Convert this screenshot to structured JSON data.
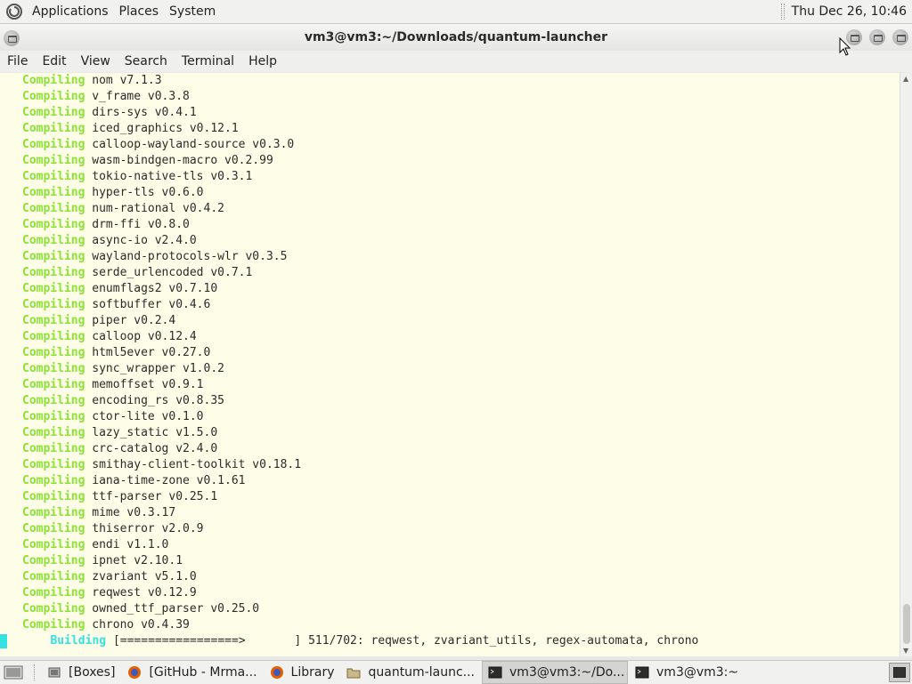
{
  "top_panel": {
    "menus": [
      "Applications",
      "Places",
      "System"
    ],
    "clock": "Thu Dec 26, 10:46"
  },
  "window": {
    "title": "vm3@vm3:~/Downloads/quantum-launcher"
  },
  "menubar": [
    "File",
    "Edit",
    "View",
    "Search",
    "Terminal",
    "Help"
  ],
  "terminal": {
    "keyword": "Compiling",
    "lines": [
      "nom v7.1.3",
      "v_frame v0.3.8",
      "dirs-sys v0.4.1",
      "iced_graphics v0.12.1",
      "calloop-wayland-source v0.3.0",
      "wasm-bindgen-macro v0.2.99",
      "tokio-native-tls v0.3.1",
      "hyper-tls v0.6.0",
      "num-rational v0.4.2",
      "drm-ffi v0.8.0",
      "async-io v2.4.0",
      "wayland-protocols-wlr v0.3.5",
      "serde_urlencoded v0.7.1",
      "enumflags2 v0.7.10",
      "softbuffer v0.4.6",
      "piper v0.2.4",
      "calloop v0.12.4",
      "html5ever v0.27.0",
      "sync_wrapper v1.0.2",
      "memoffset v0.9.1",
      "encoding_rs v0.8.35",
      "ctor-lite v0.1.0",
      "lazy_static v1.5.0",
      "crc-catalog v2.4.0",
      "smithay-client-toolkit v0.18.1",
      "iana-time-zone v0.1.61",
      "ttf-parser v0.25.1",
      "mime v0.3.17",
      "thiserror v2.0.9",
      "endi v1.1.0",
      "ipnet v2.10.1",
      "zvariant v5.1.0",
      "reqwest v0.12.9",
      "owned_ttf_parser v0.25.0",
      "chrono v0.4.39"
    ],
    "building": {
      "keyword": "Building",
      "progress_bar": "[=================>       ]",
      "status": "511/702: reqwest, zvariant_utils, regex-automata, chrono"
    }
  },
  "taskbar": {
    "items": [
      {
        "label": "[Boxes]",
        "icon": "boxes-icon",
        "active": false
      },
      {
        "label": "[GitHub - Mrma...",
        "icon": "firefox-icon",
        "active": false
      },
      {
        "label": "Library",
        "icon": "firefox-icon",
        "active": false
      },
      {
        "label": "quantum-launc...",
        "icon": "folder-icon",
        "active": false
      },
      {
        "label": "vm3@vm3:~/Do...",
        "icon": "terminal-icon",
        "active": true
      },
      {
        "label": "vm3@vm3:~",
        "icon": "terminal-icon",
        "active": false
      }
    ]
  },
  "colors": {
    "terminal_bg": "#fefee8",
    "compiling_green": "#8ae234",
    "building_cyan": "#34e2e2"
  }
}
